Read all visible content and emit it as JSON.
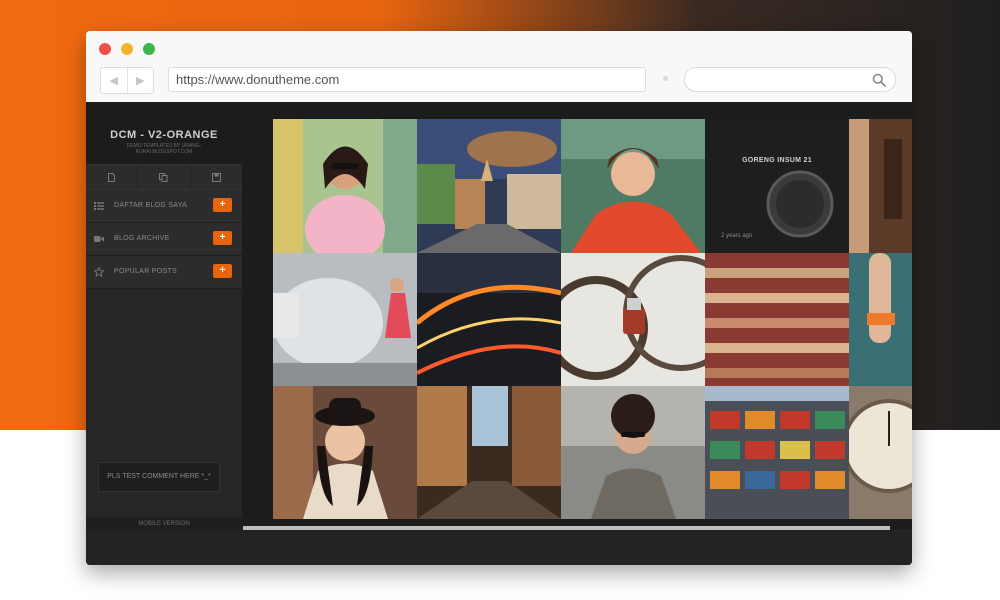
{
  "browser": {
    "url": "https://www.donutheme.com",
    "back_icon": "◀",
    "forward_icon": "▶",
    "search_icon": "search-icon"
  },
  "blog": {
    "title": "DCM - V2-ORANGE",
    "subtitle_line1": "DEMO TEMPLATES BY URANG-",
    "subtitle_line2": "KURAI.BLOGSPOT.COM",
    "tools": [
      "document-icon",
      "copy-icon",
      "save-icon"
    ],
    "menu": [
      {
        "label": "DAFTAR BLOG SAYA",
        "icon": "list-icon"
      },
      {
        "label": "BLOG ARCHIVE",
        "icon": "video-icon"
      },
      {
        "label": "POPULAR POSTS",
        "icon": "star-icon"
      }
    ],
    "menu_plus": "+",
    "comment_button": "PLS TEST COMMENT HERE *_*",
    "mobile_version": "MOBILE VERSION"
  },
  "gallery": {
    "caption_title": "GORENG INSUM 21",
    "caption_time": "2 years ago"
  },
  "colors": {
    "accent": "#e8650f",
    "page_bg_left": "#f26a10",
    "page_bg_right": "#1f1f1f",
    "blog_bg": "#1c1c1c",
    "sidebar_bg": "#262626"
  }
}
